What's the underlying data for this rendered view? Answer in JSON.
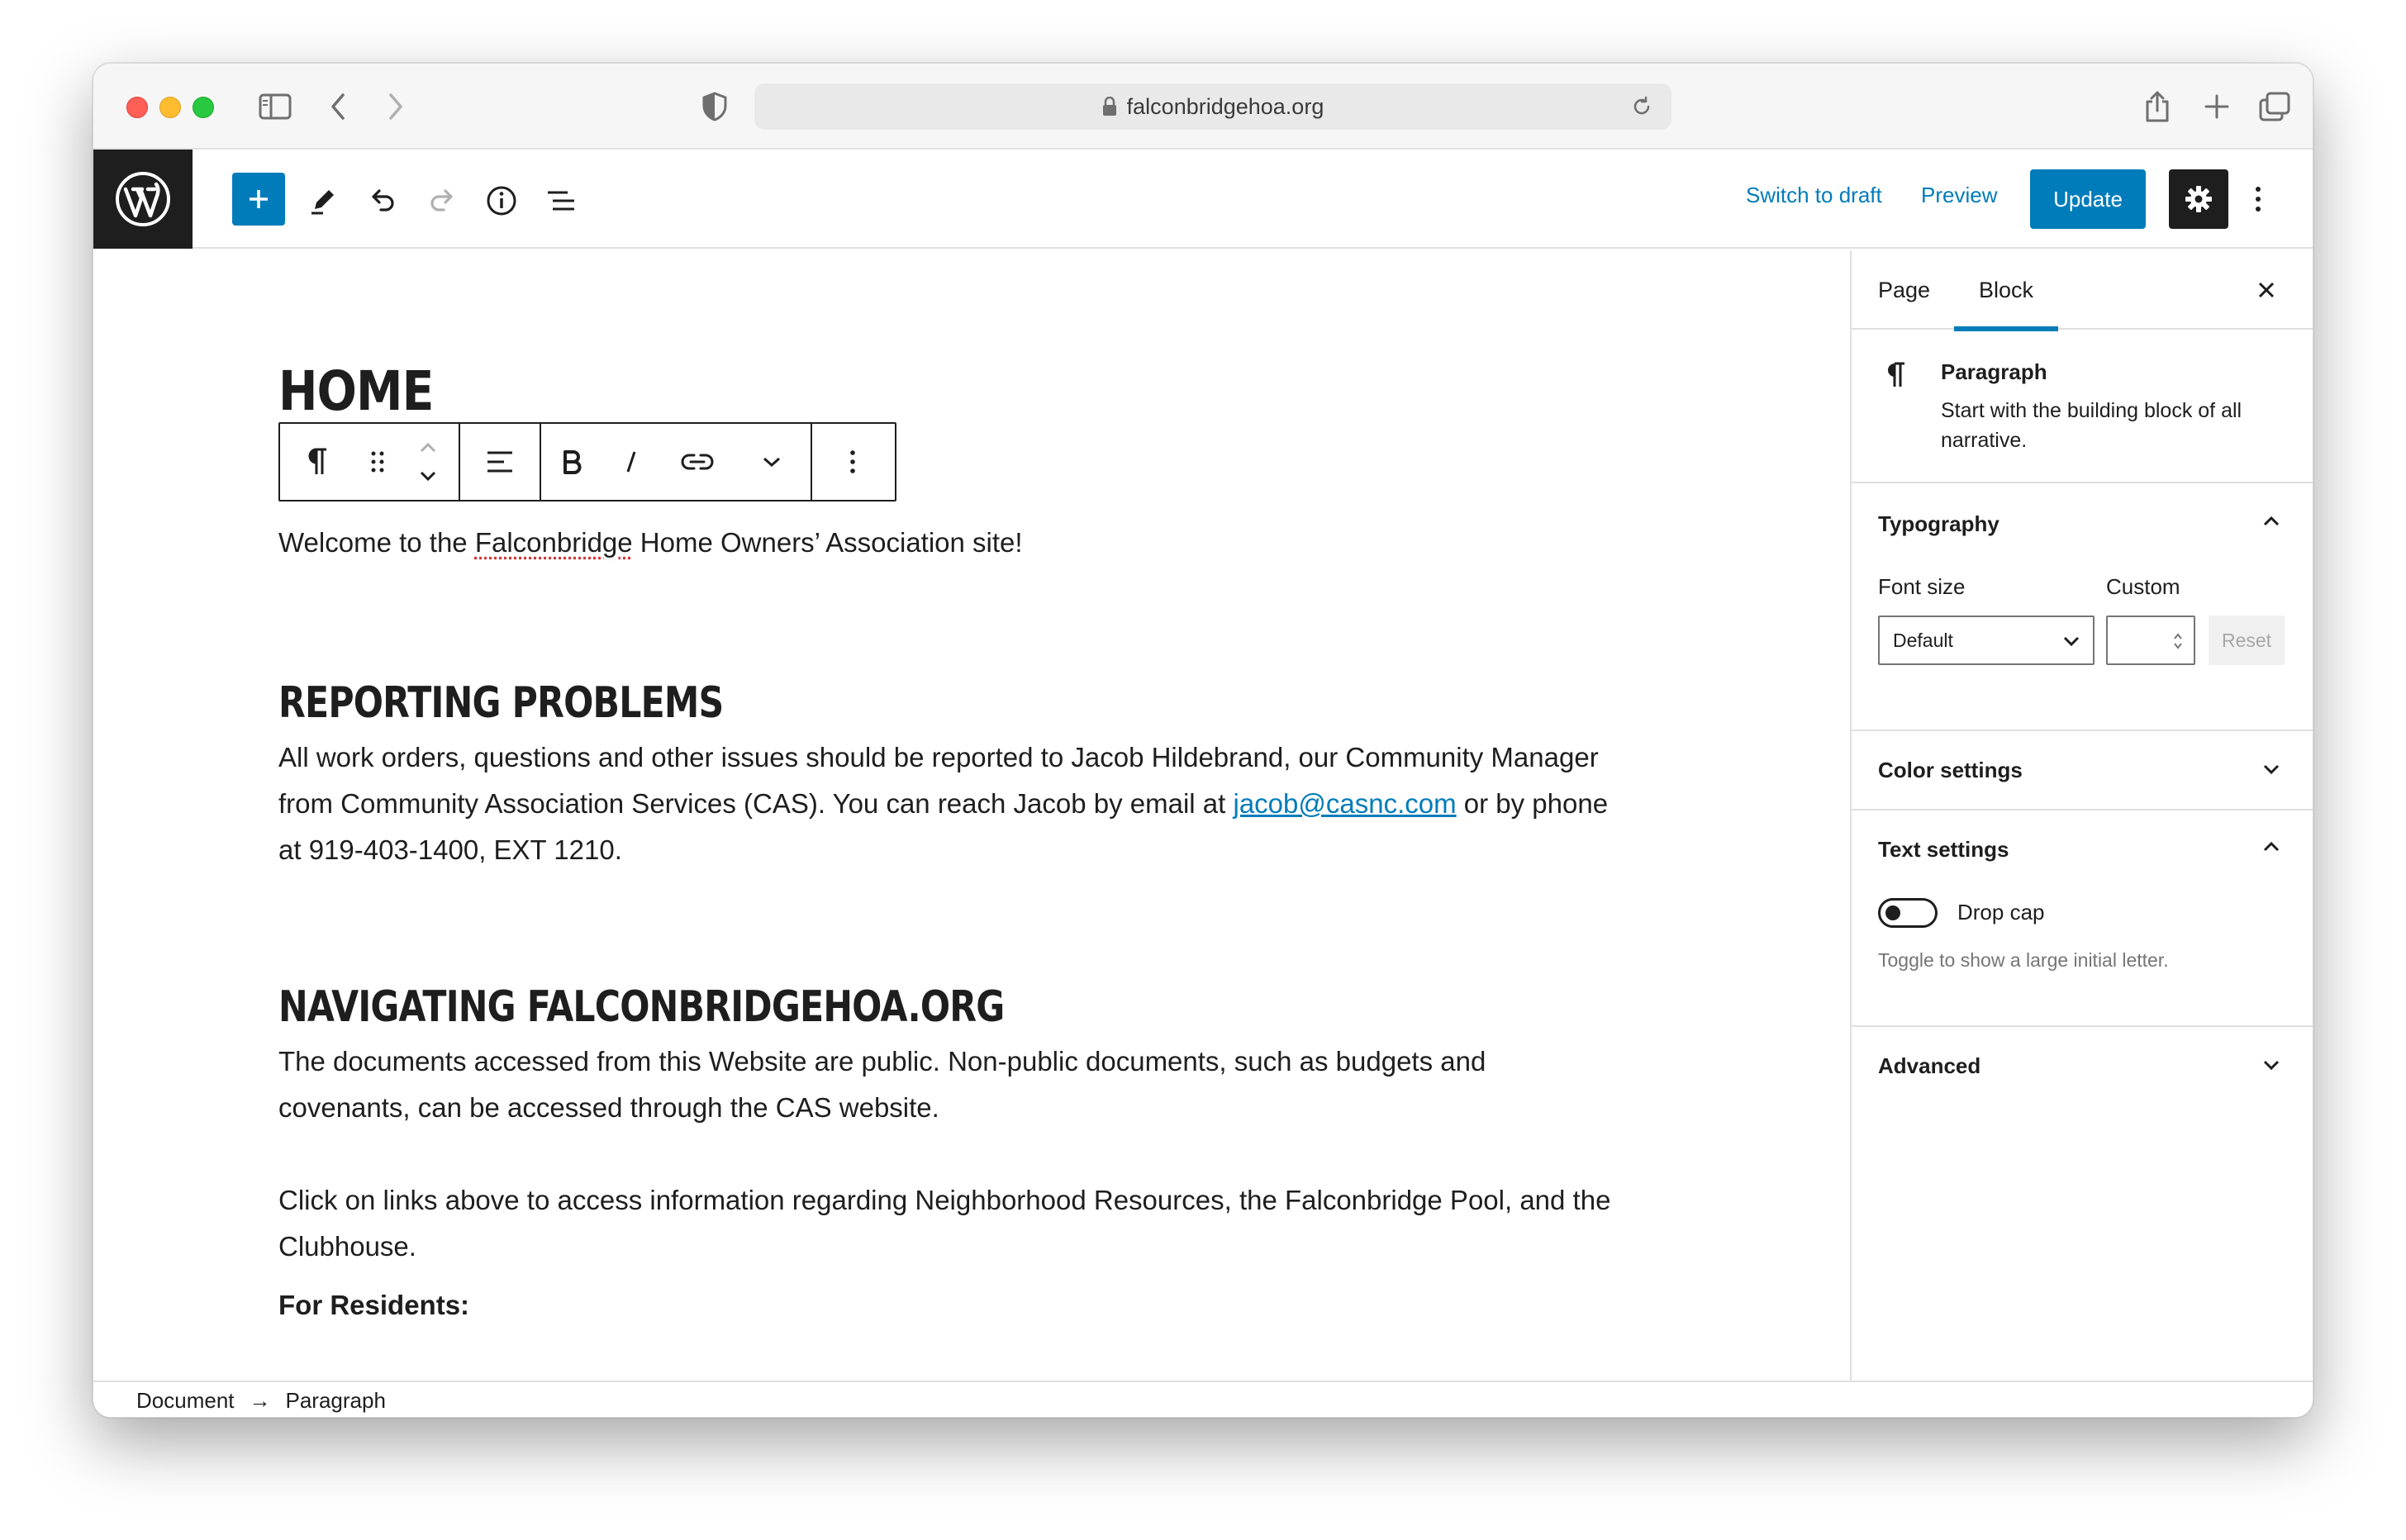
{
  "browser": {
    "url": "falconbridgehoa.org"
  },
  "header": {
    "switch_to_draft": "Switch to draft",
    "preview": "Preview",
    "update": "Update"
  },
  "editor": {
    "title": "HOME",
    "welcome": {
      "before": "Welcome to the ",
      "misspelled": "Falconbridge",
      "after": " Home Owners’ Association site!"
    },
    "heading_reporting": "REPORTING PROBLEMS",
    "reporting_para": {
      "line1": "All work orders, questions and other issues should be reported to Jacob Hildebrand, our Community Manager",
      "line2_before": "from Community Association Services (CAS). You can reach Jacob by email at ",
      "email": "jacob@casnc.com",
      "line2_after": " or by phone",
      "line3": "at 919-403-1400, EXT 1210."
    },
    "heading_navigating": "NAVIGATING FALCONBRIDGEHOA.ORG",
    "navigating_para": {
      "line1": "The documents accessed from this Website are public. Non-public documents, such as budgets and",
      "line2": "covenants, can be accessed through the CAS website."
    },
    "links_para": {
      "line1": "Click on links above to access information regarding Neighborhood Resources, the Falconbridge Pool, and the",
      "line2": "Clubhouse."
    },
    "for_residents": "For Residents:"
  },
  "breadcrumb": {
    "document": "Document",
    "arrow": "→",
    "paragraph": "Paragraph"
  },
  "sidebar": {
    "tabs": [
      "Page",
      "Block"
    ],
    "active_tab": "Block",
    "block_name": "Paragraph",
    "block_desc_line1": "Start with the building block of all",
    "block_desc_line2": "narrative.",
    "typography": {
      "title": "Typography",
      "font_size_label": "Font size",
      "custom_label": "Custom",
      "select_value": "Default",
      "reset": "Reset"
    },
    "color_settings": "Color settings",
    "text_settings": {
      "title": "Text settings",
      "drop_cap": "Drop cap",
      "help": "Toggle to show a large initial letter.",
      "drop_cap_enabled": false
    },
    "advanced": "Advanced"
  },
  "colors": {
    "accent": "#007cba",
    "dark": "#1e1e1e"
  }
}
